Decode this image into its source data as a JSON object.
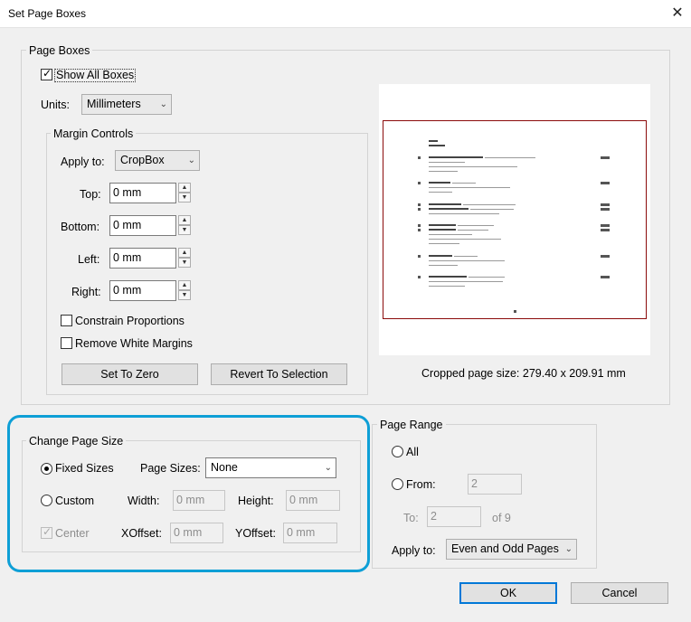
{
  "window": {
    "title": "Set Page Boxes",
    "close_glyph": "✕"
  },
  "page_boxes": {
    "legend": "Page Boxes",
    "show_all_boxes": {
      "label": "Show All Boxes",
      "checked": true
    },
    "units": {
      "label": "Units:",
      "value": "Millimeters"
    },
    "margin_controls": {
      "legend": "Margin Controls",
      "apply_to": {
        "label": "Apply to:",
        "value": "CropBox"
      },
      "top": {
        "label": "Top:",
        "value": "0 mm"
      },
      "bottom": {
        "label": "Bottom:",
        "value": "0 mm"
      },
      "left": {
        "label": "Left:",
        "value": "0 mm"
      },
      "right": {
        "label": "Right:",
        "value": "0 mm"
      },
      "constrain_proportions": "Constrain Proportions",
      "remove_white_margins": "Remove White Margins",
      "set_to_zero": "Set To Zero",
      "revert_to_selection": "Revert To Selection"
    },
    "cropped_size": "Cropped page size: 279.40 x 209.91 mm"
  },
  "change_page_size": {
    "legend": "Change Page Size",
    "fixed_sizes": "Fixed Sizes",
    "page_sizes": {
      "label": "Page Sizes:",
      "value": "None"
    },
    "custom": "Custom",
    "width": {
      "label": "Width:",
      "value": "0 mm"
    },
    "height": {
      "label": "Height:",
      "value": "0 mm"
    },
    "center": "Center",
    "xoffset": {
      "label": "XOffset:",
      "value": "0 mm"
    },
    "yoffset": {
      "label": "YOffset:",
      "value": "0 mm"
    }
  },
  "page_range": {
    "legend": "Page Range",
    "all": "All",
    "from": {
      "label": "From:",
      "value": "2"
    },
    "to": {
      "label": "To:",
      "value": "2"
    },
    "of": "of 9",
    "apply_to": {
      "label": "Apply to:",
      "value": "Even and Odd Pages"
    }
  },
  "buttons": {
    "ok": "OK",
    "cancel": "Cancel"
  },
  "colors": {
    "highlight": "#0e9fd6",
    "crop_box": "#8b0b0b",
    "default_button": "#0078d7"
  }
}
